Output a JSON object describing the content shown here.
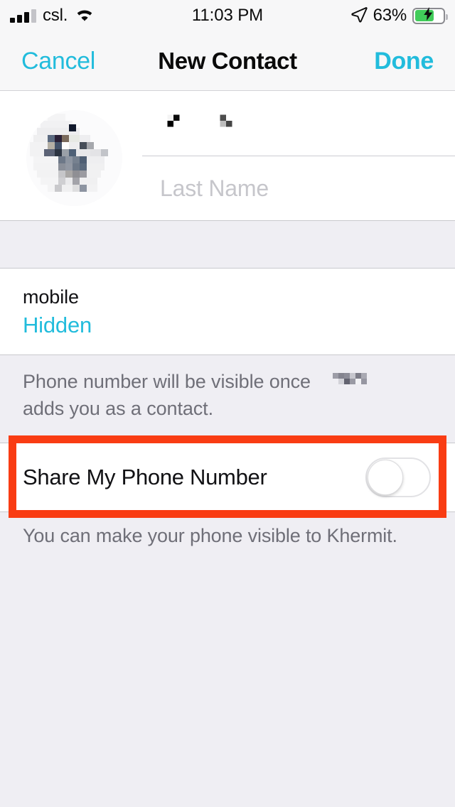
{
  "status_bar": {
    "carrier": "csl.",
    "time": "11:03 PM",
    "battery_percent": "63%",
    "battery_level": 63,
    "charging": true,
    "signal_bars_filled": 3,
    "signal_bars_total": 4,
    "wifi": "wifi-icon",
    "location": "location-arrow-icon"
  },
  "nav": {
    "cancel_label": "Cancel",
    "title": "New Contact",
    "done_label": "Done"
  },
  "name_section": {
    "avatar_alt": "contact-photo",
    "first_name_value": "",
    "first_name_redacted": true,
    "last_name_placeholder": "Last Name",
    "last_name_value": ""
  },
  "phone_section": {
    "label": "mobile",
    "value": "Hidden"
  },
  "footer_note_1": {
    "line1_before": "Phone number will be visible once",
    "line1_redacted": true,
    "line2": "adds you as a contact."
  },
  "toggle_row": {
    "label": "Share My Phone Number",
    "state": "off",
    "highlighted": true
  },
  "footer_note_2": {
    "text": "You can make your phone visible to Khermit."
  },
  "colors": {
    "accent": "#22bcdc",
    "highlight": "#f93c13",
    "background": "#efeef3",
    "card": "#ffffff",
    "nav_bg": "#f7f7f8",
    "battery_green": "#41cc5a",
    "secondary_text": "#6f6f78",
    "placeholder_text": "#c6c6cb"
  }
}
